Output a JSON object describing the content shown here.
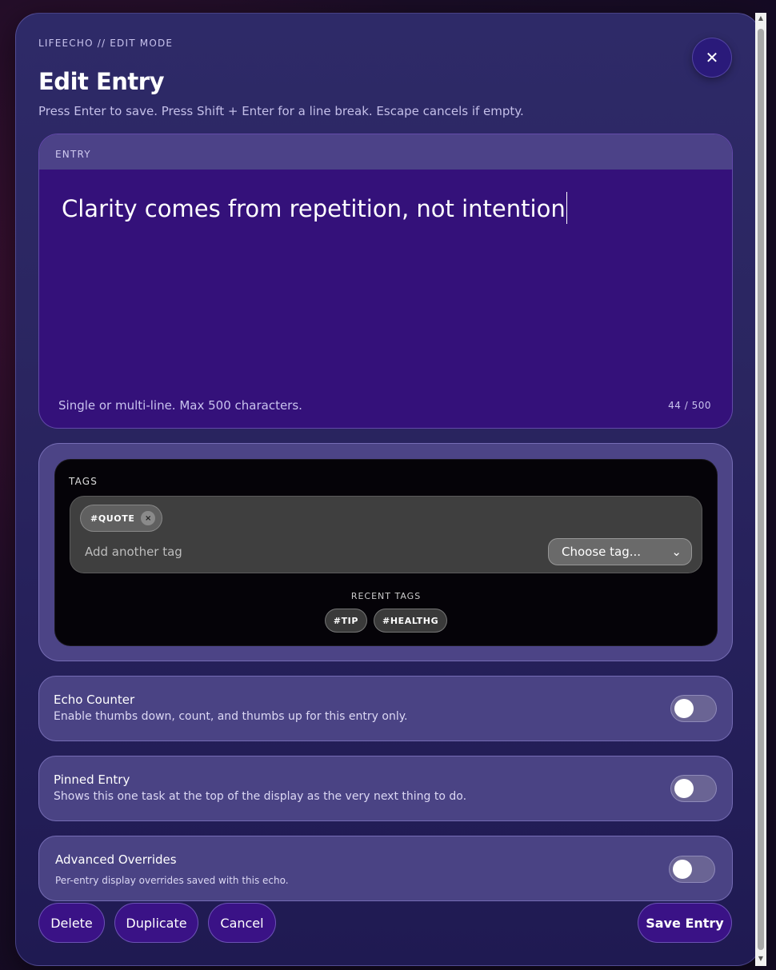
{
  "modal": {
    "eyebrow": "LIFEECHO // EDIT MODE",
    "title": "Edit Entry",
    "hint": "Press Enter to save. Press Shift + Enter for a line break. Escape cancels if empty.",
    "close_glyph": "✕"
  },
  "entry": {
    "label": "ENTRY",
    "value": "Clarity comes from repetition, not intention",
    "help": "Single or multi-line. Max 500 characters.",
    "count": "44 / 500"
  },
  "tags": {
    "label": "TAGS",
    "chips": [
      {
        "label": "#QUOTE",
        "remove_glyph": "×"
      }
    ],
    "input_placeholder": "Add another tag",
    "select_value": "Choose tag...",
    "select_caret": "⌄",
    "recent_label": "RECENT TAGS",
    "recent": [
      "#TIP",
      "#HEALTHG"
    ]
  },
  "options": [
    {
      "title": "Echo Counter",
      "desc": "Enable thumbs down, count, and thumbs up for this entry only.",
      "enabled": false
    },
    {
      "title": "Pinned Entry",
      "desc": "Shows this one task at the top of the display as the very next thing to do.",
      "enabled": false
    },
    {
      "title": "Advanced Overrides",
      "desc": "Per-entry display overrides saved with this echo.",
      "enabled": false
    }
  ],
  "buttons": {
    "delete": "Delete",
    "duplicate": "Duplicate",
    "cancel": "Cancel",
    "save": "Save Entry"
  },
  "scrollbar": {
    "up": "▲",
    "down": "▼"
  }
}
